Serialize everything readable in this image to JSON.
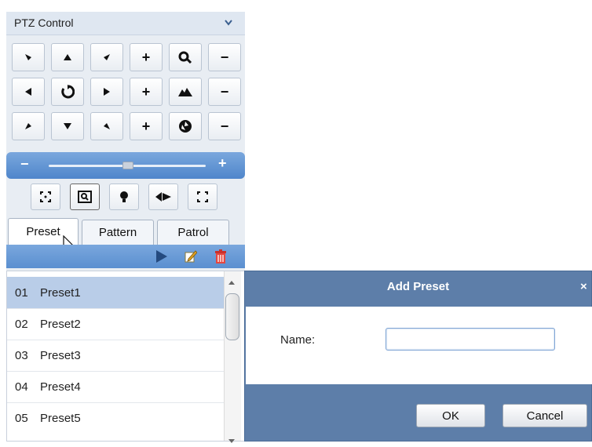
{
  "ptz": {
    "title": "PTZ Control",
    "collapse_icon": "chevron-down-icon",
    "direction_pad": [
      "arrow-up-left-icon",
      "arrow-up-icon",
      "arrow-up-right-icon",
      "arrow-left-icon",
      "auto-scan-icon",
      "arrow-right-icon",
      "arrow-down-left-icon",
      "arrow-down-icon",
      "arrow-down-right-icon"
    ],
    "zoom": {
      "plus": "+",
      "minus": "−",
      "icon": "zoom-icon"
    },
    "focus": {
      "plus": "+",
      "minus": "−",
      "icon": "focus-icon"
    },
    "iris": {
      "plus": "+",
      "minus": "−",
      "icon": "iris-icon"
    },
    "speed": {
      "minus": "−",
      "plus": "+",
      "value_fraction": 0.5
    },
    "tools": [
      "3d-positioning-icon",
      "region-zoom-icon",
      "light-icon",
      "wiper-icon",
      "lens-init-icon"
    ],
    "tabs": [
      "Preset",
      "Pattern",
      "Patrol"
    ],
    "active_tab": "Preset",
    "toolbar_icons": [
      "play-icon",
      "edit-icon",
      "delete-icon"
    ],
    "presets": [
      {
        "num": "01",
        "name": "Preset1"
      },
      {
        "num": "02",
        "name": "Preset2"
      },
      {
        "num": "03",
        "name": "Preset3"
      },
      {
        "num": "04",
        "name": "Preset4"
      },
      {
        "num": "05",
        "name": "Preset5"
      }
    ]
  },
  "dialog": {
    "title": "Add Preset",
    "close": "×",
    "name_label": "Name:",
    "name_value": "",
    "ok": "OK",
    "cancel": "Cancel"
  },
  "colors": {
    "accent": "#4f86cb",
    "dialog_frame": "#5d7ea9",
    "selected_row": "#b9cde8"
  }
}
